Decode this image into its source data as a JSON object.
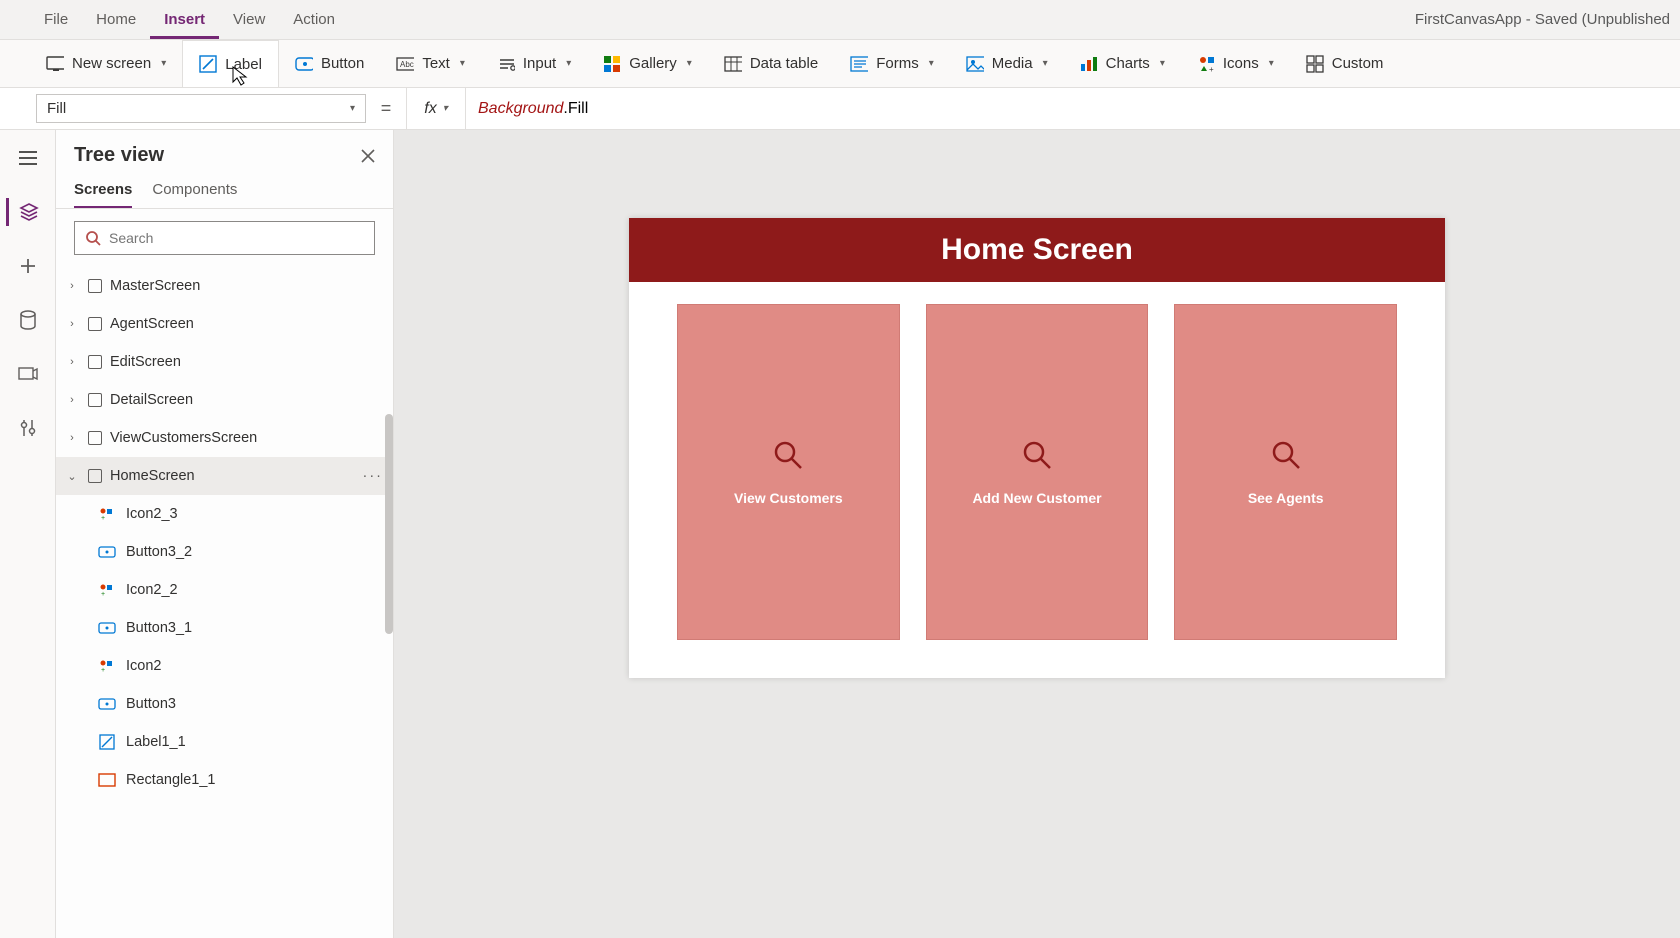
{
  "menu": {
    "file": "File",
    "home": "Home",
    "insert": "Insert",
    "view": "View",
    "action": "Action"
  },
  "app_title": "FirstCanvasApp - Saved (Unpublished",
  "ribbon": {
    "new_screen": "New screen",
    "label": "Label",
    "button": "Button",
    "text": "Text",
    "input": "Input",
    "gallery": "Gallery",
    "data_table": "Data table",
    "forms": "Forms",
    "media": "Media",
    "charts": "Charts",
    "icons": "Icons",
    "custom": "Custom"
  },
  "property": "Fill",
  "formula": {
    "obj": "Background",
    "prop": ".Fill"
  },
  "panel": {
    "title": "Tree view",
    "tab_screens": "Screens",
    "tab_components": "Components",
    "search_placeholder": "Search"
  },
  "tree": {
    "screens": [
      {
        "name": "MasterScreen"
      },
      {
        "name": "AgentScreen"
      },
      {
        "name": "EditScreen"
      },
      {
        "name": "DetailScreen"
      },
      {
        "name": "ViewCustomersScreen"
      },
      {
        "name": "HomeScreen",
        "expanded": true,
        "selected": true
      }
    ],
    "home_children": [
      {
        "name": "Icon2_3",
        "kind": "icon"
      },
      {
        "name": "Button3_2",
        "kind": "button"
      },
      {
        "name": "Icon2_2",
        "kind": "icon"
      },
      {
        "name": "Button3_1",
        "kind": "button"
      },
      {
        "name": "Icon2",
        "kind": "icon"
      },
      {
        "name": "Button3",
        "kind": "button"
      },
      {
        "name": "Label1_1",
        "kind": "label"
      },
      {
        "name": "Rectangle1_1",
        "kind": "rect"
      }
    ]
  },
  "canvas": {
    "header": "Home Screen",
    "cards": [
      {
        "label": "View Customers"
      },
      {
        "label": "Add New Customer"
      },
      {
        "label": "See Agents"
      }
    ]
  }
}
